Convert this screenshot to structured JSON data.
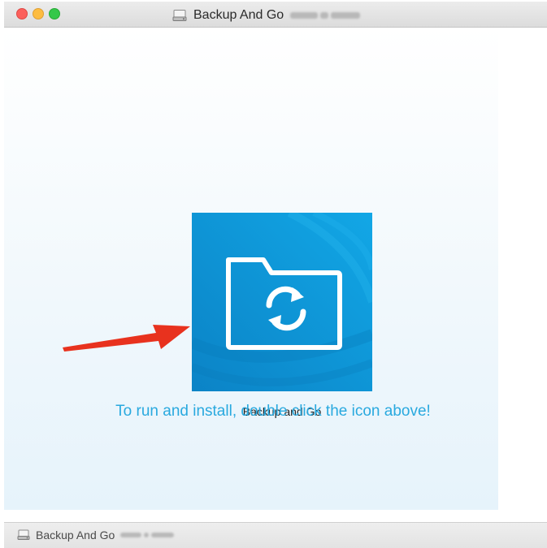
{
  "window": {
    "title": "Backup And Go",
    "title_icon": "disk-icon",
    "traffic_lights": {
      "close_color": "#fc605c",
      "minimize_color": "#fdbc40",
      "maximize_color": "#34c84a"
    }
  },
  "content": {
    "app_icon": {
      "name": "folder-sync-icon",
      "background_color": "#0a91d4",
      "label": "Backup and Go"
    },
    "instruction": "To run and install, double click the icon above!",
    "instruction_color": "#29a9df",
    "arrow_color": "#e8321e"
  },
  "statusbar": {
    "text": "Backup And Go",
    "icon": "disk-icon"
  }
}
